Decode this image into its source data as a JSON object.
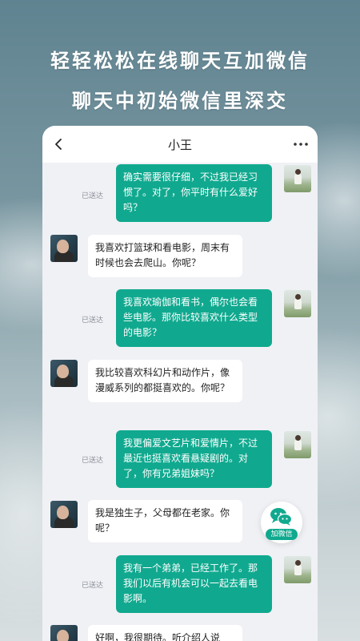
{
  "headline": {
    "line1": "轻轻松松在线聊天互加微信",
    "line2": "聊天中初始微信里深交"
  },
  "chat": {
    "title": "小王",
    "back_icon": "chevron-left-icon",
    "more_icon": "more-dots-icon",
    "sent_status": "已送达",
    "messages": [
      {
        "from": "me",
        "text": "确实需要很仔细，不过我已经习惯了。对了，你平时有什么爱好吗？",
        "status": "已送达"
      },
      {
        "from": "them",
        "text": "我喜欢打篮球和看电影，周末有时候也会去爬山。你呢？"
      },
      {
        "from": "me",
        "text": "我喜欢瑜伽和看书，偶尔也会看些电影。那你比较喜欢什么类型的电影？",
        "status": "已送达"
      },
      {
        "from": "them",
        "text": "我比较喜欢科幻片和动作片，像漫威系列的都挺喜欢的。你呢？"
      },
      {
        "from": "me",
        "text": "我更偏爱文艺片和爱情片，不过最近也挺喜欢看悬疑剧的。对了，你有兄弟姐妹吗？",
        "status": "已送达"
      },
      {
        "from": "them",
        "text": "我是独生子，父母都在老家。你呢？"
      },
      {
        "from": "me",
        "text": "我有一个弟弟，已经工作了。那我们以后有机会可以一起去看电影啊。",
        "status": "已送达"
      },
      {
        "from": "them",
        "text": "好啊，我很期待。听介绍人说"
      }
    ]
  },
  "wechat_button": {
    "label": "加微信",
    "icon": "wechat-icon"
  },
  "colors": {
    "accent": "#10a98f",
    "chat_bg": "#f0f1f5",
    "bubble_them": "#ffffff"
  }
}
